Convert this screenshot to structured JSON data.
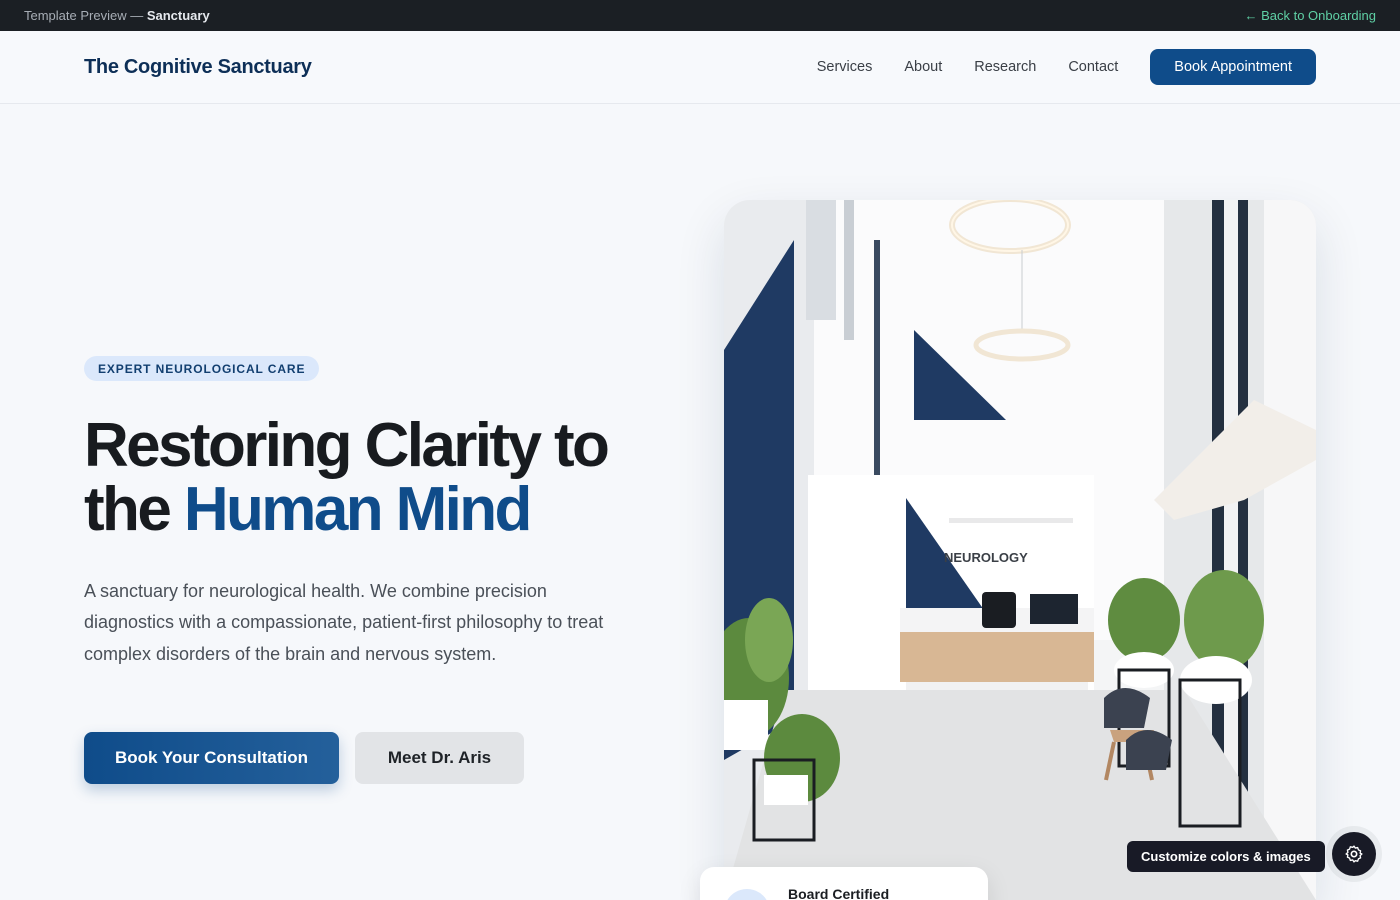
{
  "preview_bar": {
    "label_prefix": "Template Preview —",
    "label_name": "Sanctuary",
    "back_link": "← Back to Onboarding"
  },
  "header": {
    "brand": "The Cognitive Sanctuary",
    "nav": [
      "Services",
      "About",
      "Research",
      "Contact"
    ],
    "cta": "Book Appointment"
  },
  "hero": {
    "pill": "EXPERT NEUROLOGICAL CARE",
    "title_part1": "Restoring Clarity to the",
    "title_accent": "Human Mind",
    "description": "A sanctuary for neurological health. We combine precision diagnostics with a compassionate, patient-first philosophy to treat complex disorders of the brain and nervous system.",
    "primary_button": "Book Your Consultation",
    "secondary_button": "Meet Dr. Aris",
    "image_sign_1": "NEUROLOGY",
    "image_sign_2": "NEUROLOGY",
    "badge_title": "Board Certified"
  },
  "customize": {
    "tooltip": "Customize colors & images",
    "icon": "gear-icon"
  },
  "colors": {
    "brand_blue": "#0f4c8a",
    "pill_bg": "#dbe8fb",
    "back_link": "#5fd0a5",
    "dark_bar": "#1b1f24"
  }
}
